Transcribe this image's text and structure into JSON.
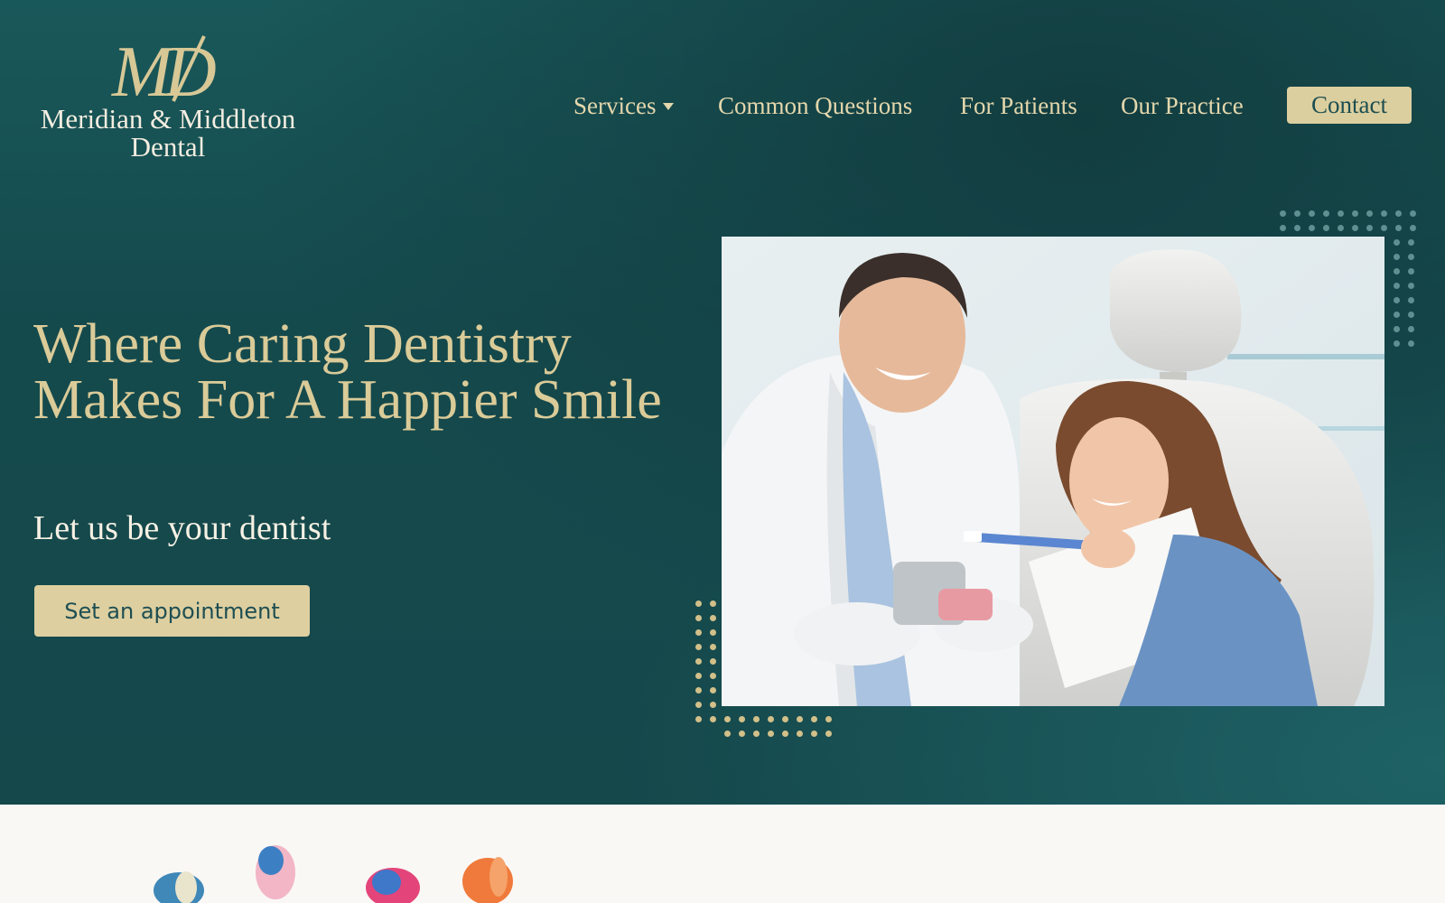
{
  "logo": {
    "monogram": "MD",
    "name_line1": "Meridian & Middleton",
    "name_line2": "Dental"
  },
  "nav": {
    "services": "Services",
    "common_questions": "Common Questions",
    "for_patients": "For Patients",
    "our_practice": "Our Practice",
    "contact": "Contact"
  },
  "hero": {
    "headline": "Where Caring Dentistry Makes For A Happier Smile",
    "subheadline": "Let us be your dentist",
    "cta_label": "Set an appointment",
    "image_alt": "Smiling dentist showing a young girl how to brush teeth on a dental model"
  },
  "colors": {
    "hero_bg": "#17504f",
    "accent_gold": "#dccf9f",
    "headline_gold": "#dacb98",
    "page_bg": "#faf8f5"
  }
}
